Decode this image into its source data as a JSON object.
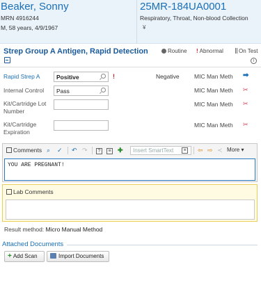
{
  "patient": {
    "name": "Beaker, Sonny",
    "mrn": "MRN 4916244",
    "demographics": "M, 58 years, 4/9/1967"
  },
  "specimen": {
    "accession": "25MR-184UA0001",
    "description": "Respiratory, Throat, Non-blood Collection",
    "icon": "ordered-on-test-icon"
  },
  "test": {
    "title": "Strep Group A Antigen, Rapid Detection",
    "legend": {
      "routine": "Routine",
      "abnormal": "Abnormal",
      "on_test": "On Test"
    }
  },
  "results": [
    {
      "label": "Rapid Strep A",
      "value": "Positive",
      "abnormal": "!",
      "interpretation": "Negative",
      "method": "MIC Man Meth"
    },
    {
      "label": "Internal Control",
      "value": "Pass",
      "abnormal": "",
      "interpretation": "",
      "method": "MIC Man Meth"
    },
    {
      "label": "Kit/Cartridge Lot Number",
      "value": "",
      "abnormal": "",
      "interpretation": "",
      "method": "MIC Man Meth"
    },
    {
      "label": "Kit/Cartridge Expiration",
      "value": "",
      "abnormal": "",
      "interpretation": "",
      "method": "MIC Man Meth"
    }
  ],
  "comments": {
    "label": "Comments",
    "smarttext_placeholder": "Insert SmartText",
    "more_label": "More",
    "text": "YOU ARE PREGNANT!"
  },
  "lab_comments": {
    "label": "Lab Comments"
  },
  "result_method": {
    "label": "Result method:",
    "value": "Micro Manual Method"
  },
  "attached_documents": {
    "title": "Attached Documents",
    "add_scan_label": "Add Scan",
    "import_label": "Import Documents"
  },
  "colors": {
    "accent": "#1a6fb5",
    "abnormal": "#c0202b",
    "header_bg": "#eaf2fa",
    "lab_panel_bg": "#fffbe3"
  }
}
